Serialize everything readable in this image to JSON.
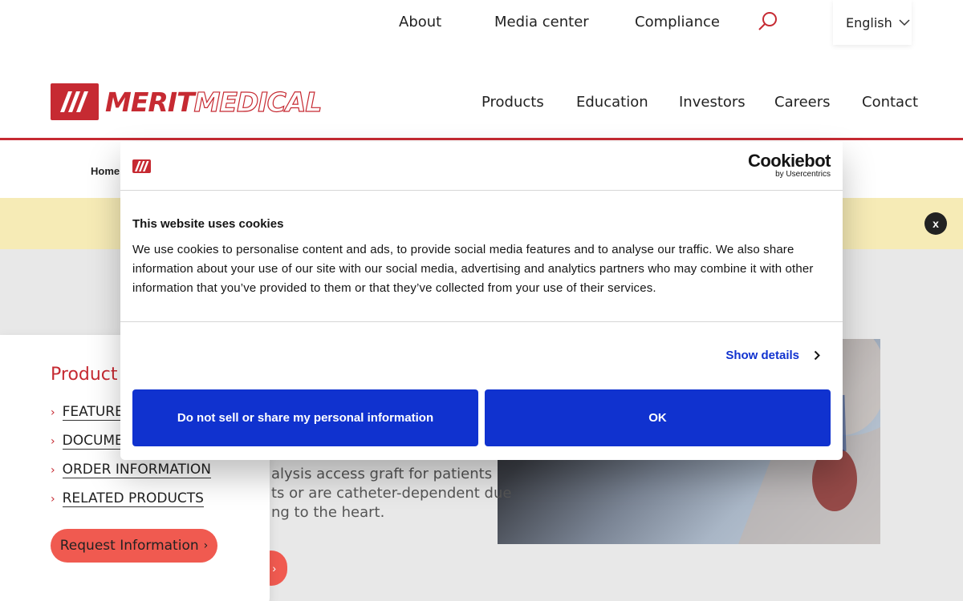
{
  "topbar": {
    "links": [
      "About",
      "Media center",
      "Compliance"
    ],
    "language": "English"
  },
  "header": {
    "logo_text_bold": "MERIT",
    "logo_text_outline": "MEDICAL",
    "nav": [
      "Products",
      "Education",
      "Investors",
      "Careers",
      "Contact"
    ]
  },
  "breadcrumb": {
    "home": "Home"
  },
  "alert": {
    "close": "x"
  },
  "hero": {
    "description_lines": [
      "alysis access graft for patients",
      "ts or are catheter-dependent due",
      "ng to the heart."
    ]
  },
  "sidebar": {
    "title": "Product",
    "links": [
      "FEATURES",
      "DOCUMENTS",
      "ORDER INFORMATION",
      "RELATED PRODUCTS"
    ],
    "request_button": "Request Information"
  },
  "cookie": {
    "brand": "Cookiebot",
    "brand_sub": "by Usercentrics",
    "title": "This website uses cookies",
    "text": "We use cookies to personalise content and ads, to provide social media features and to analyse our traffic. We also share information about your use of our site with our social media, advertising and analytics partners who may combine it with other information that you’ve provided to them or that they’ve collected from your use of their services.",
    "show_details": "Show details",
    "btn_do_not_sell": "Do not sell or share my personal information",
    "btn_ok": "OK"
  },
  "colors": {
    "brand_red": "#c62a32",
    "cookie_blue": "#1032cf",
    "alert_yellow": "#f6ebb6",
    "cta_coral": "#f05a50"
  },
  "icons": [
    "search-icon",
    "chevron-down-icon",
    "chevron-right-icon",
    "close-icon"
  ]
}
